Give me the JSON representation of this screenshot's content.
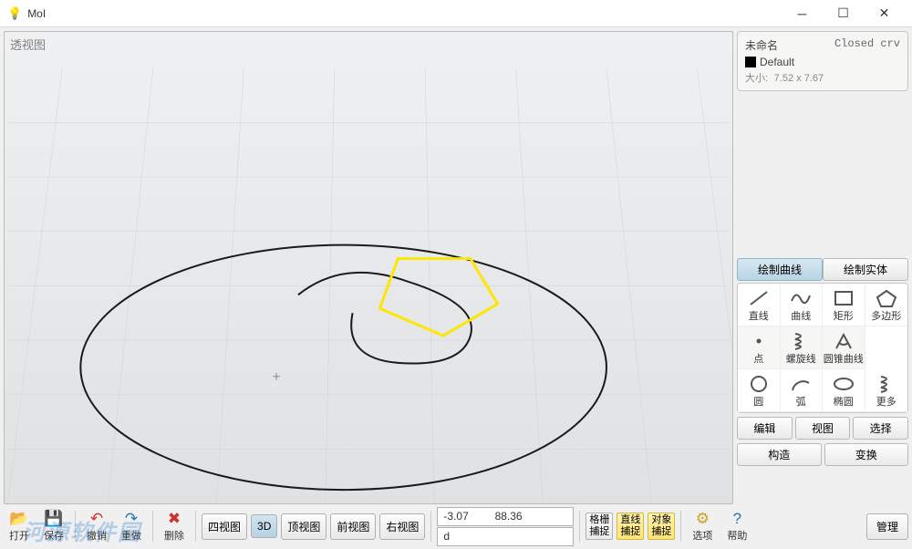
{
  "window": {
    "title": "MoI"
  },
  "viewport": {
    "label": "透视图"
  },
  "info": {
    "name": "未命名",
    "type": "Closed crv",
    "layer": "Default",
    "size_label": "大小:",
    "size": "7.52 x 7.67"
  },
  "tabs": {
    "curves": "绘制曲线",
    "solids": "绘制实体"
  },
  "tools": {
    "line": "直线",
    "curve": "曲线",
    "rect": "矩形",
    "polygon": "多边形",
    "point": "点",
    "helix": "螺旋线",
    "conic": "圆锥曲线",
    "circle": "圆",
    "arc": "弧",
    "ellipse": "椭圆",
    "more": "更多"
  },
  "sidebuttons": {
    "edit": "编辑",
    "view": "视图",
    "select": "选择",
    "construct": "构造",
    "transform": "变换"
  },
  "bottom": {
    "open": "打开",
    "save": "保存",
    "undo": "撤销",
    "redo": "重做",
    "delete": "删除",
    "quad": "四视图",
    "threeD": "3D",
    "top": "顶视图",
    "front": "前视图",
    "right": "右视图",
    "coord_x": "-3.07",
    "coord_y": "88.36",
    "d_prefix": "d",
    "grid1": "格栅",
    "grid2": "捕捉",
    "line1": "直线",
    "line2": "捕捉",
    "obj1": "对象",
    "obj2": "捕捉",
    "options": "选项",
    "help": "帮助",
    "manage": "管理"
  },
  "chart_data": {
    "type": "other",
    "title": "3D viewport curves",
    "objects": [
      {
        "kind": "ellipse",
        "cx_approx": 0,
        "cy_approx": 0,
        "note": "large outer ellipse"
      },
      {
        "kind": "ellipse",
        "note": "inner curve with swoop"
      },
      {
        "kind": "polygon",
        "color": "#ffe600",
        "sides": 5,
        "size": "7.52 x 7.67",
        "status": "selected Closed crv"
      }
    ]
  }
}
